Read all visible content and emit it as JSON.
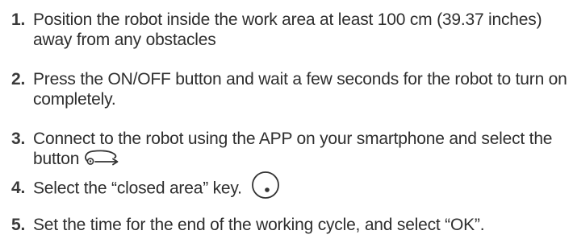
{
  "steps": [
    {
      "number": "1.",
      "text": "Position the robot inside the work area at least 100 cm (39.37 inches) away from any obstacles"
    },
    {
      "number": "2.",
      "text": "Press the ON/OFF button and wait a few seconds for the robot to turn on completely."
    },
    {
      "number": "3.",
      "text": "Connect to the robot using the APP on your smartphone and select the button",
      "icon": "path-loop-icon"
    },
    {
      "number": "4.",
      "text": "Select the “closed area” key.",
      "icon": "closed-area-icon"
    },
    {
      "number": "5.",
      "text": "Set the time for the end of the working cycle, and select “OK”."
    }
  ],
  "colors": {
    "text": "#2e2e2e",
    "number": "#3a3a3a",
    "icon_stroke": "#333333"
  }
}
